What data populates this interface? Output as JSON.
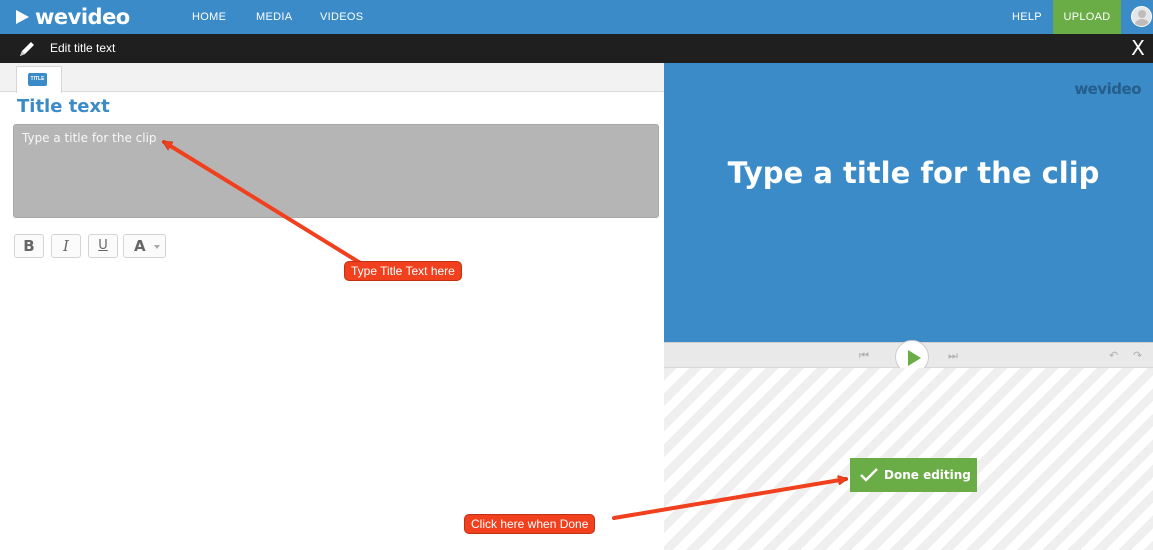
{
  "topnav": {
    "logo": "wevideo",
    "links": [
      "HOME",
      "MEDIA",
      "VIDEOS"
    ],
    "help": "HELP",
    "upload": "UPLOAD"
  },
  "subbar": {
    "title": "Edit title text",
    "close": "X"
  },
  "editor": {
    "tab_badge": "TITLE",
    "section_title": "Title text",
    "textarea_placeholder": "Type a title for the clip",
    "format_buttons": {
      "bold": "B",
      "italic": "I",
      "underline": "U",
      "font": "A"
    }
  },
  "preview": {
    "watermark": "wevideo",
    "title": "Type a title for the clip"
  },
  "player": {
    "prev": "⏮",
    "next": "⏭",
    "undo": "↶",
    "redo": "↷"
  },
  "done_button": "Done editing",
  "annotations": {
    "callout_1": "Type Title Text here",
    "callout_2": "Click here when Done"
  },
  "colors": {
    "brand": "#3a8bc7",
    "accent_green": "#6aac45",
    "callout_red": "#f0401e"
  }
}
